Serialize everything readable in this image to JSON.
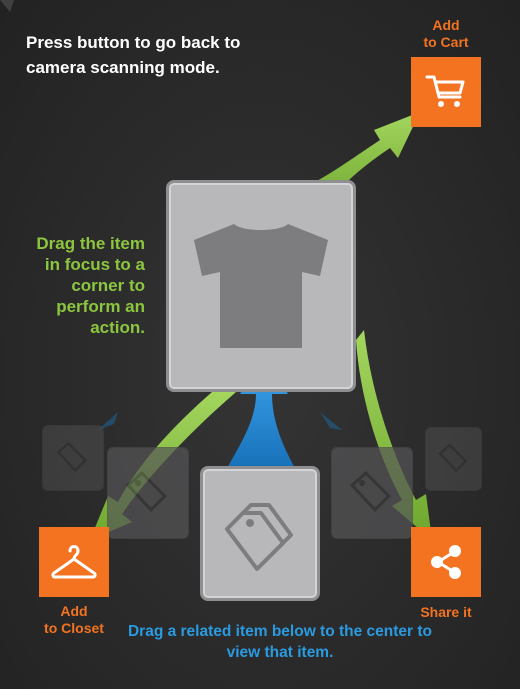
{
  "instructions": {
    "camera": "Press button to go back to camera scanning mode.",
    "focus": "Drag the item in focus to a corner to perform an action.",
    "related": "Drag a related item below to the center to view that item."
  },
  "actions": {
    "cart": {
      "label": "Add\nto Cart",
      "icon": "shopping-cart-icon"
    },
    "closet": {
      "label": "Add\nto Closet",
      "icon": "hanger-icon"
    },
    "share": {
      "label": "Share it",
      "icon": "share-icon"
    }
  },
  "focus_item": {
    "icon": "tshirt-icon"
  },
  "related_items": {
    "icon": "price-tag-icon"
  },
  "colors": {
    "background": "#2b2b2b",
    "accent_orange": "#f47321",
    "instruction_green": "#8cc63f",
    "instruction_blue": "#2a9be0",
    "arrow_green": "#8cc63f",
    "arrow_blue": "#1e88d8"
  }
}
